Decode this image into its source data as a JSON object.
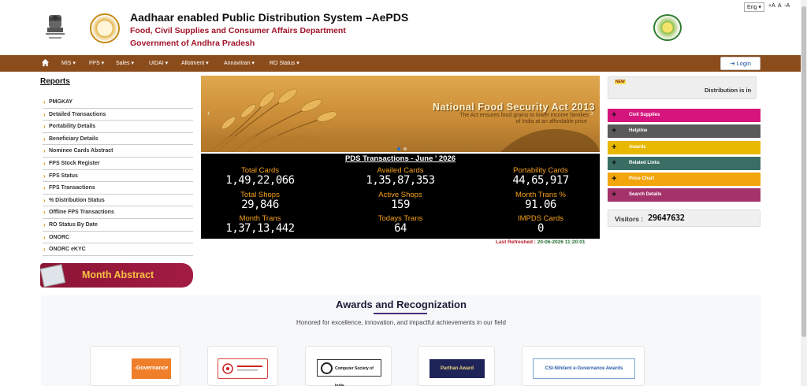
{
  "header": {
    "title": "Aadhaar enabled Public Distribution System –AePDS",
    "dept": "Food, Civil Supplies and Consumer Affairs Department",
    "govt": "Government of Andhra Pradesh",
    "language": "Eng",
    "font_size_controls": "+A  A  -A"
  },
  "nav": {
    "items": [
      "MIS",
      "FPS",
      "Sales",
      "UIDAI",
      "Allotment",
      "Annavitran",
      "RO Status"
    ],
    "login_label": "Login"
  },
  "reports": {
    "title": "Reports",
    "items": [
      "PMGKAY",
      "Detailed Transactions",
      "Portability Details",
      "Beneficiary Details",
      "Nominee Cards Abstract",
      "FPS Stock Register",
      "FPS Status",
      "FPS Transactions",
      "% Distribution Status",
      "Offline FPS Transactions",
      "RO Status By Date",
      "ONORC",
      "ONORC eKYC"
    ],
    "month_abstract": "Month Abstract"
  },
  "banner": {
    "title": "National Food Security Act 2013",
    "line1": "The Act ensures food grains to lower income families",
    "line2": "of India at an affordable price"
  },
  "stats": {
    "heading": "PDS Transactions - June ' 2026",
    "items": [
      {
        "label": "Total Cards",
        "value": "1,49,22,066"
      },
      {
        "label": "Availed Cards",
        "value": "1,35,87,353"
      },
      {
        "label": "Portability Cards",
        "value": "44,65,917"
      },
      {
        "label": "Total Shops",
        "value": "29,846"
      },
      {
        "label": "Active Shops",
        "value": "159"
      },
      {
        "label": "Month Trans %",
        "value": "91.06"
      },
      {
        "label": "Month Trans",
        "value": "1,37,13,442"
      },
      {
        "label": "Todays Trans",
        "value": "64"
      },
      {
        "label": "IMPDS Cards",
        "value": "0"
      }
    ],
    "refreshed_label": "Last Refreshed : ",
    "refreshed_value": "20-06-2026 11:20:01"
  },
  "right": {
    "news_badge": "NEW",
    "news_text": "Distribution is in",
    "links": [
      {
        "label": "Civil Supplies",
        "color": "#d6147d"
      },
      {
        "label": "Helpline",
        "color": "#5a5a5a"
      },
      {
        "label": "Awards",
        "color": "#e8b800"
      },
      {
        "label": "Related Links",
        "color": "#3a6e64"
      },
      {
        "label": "Price Chart",
        "color": "#f2a50c"
      },
      {
        "label": "Search Details",
        "color": "#a3336a"
      }
    ],
    "visitors_label": "Visitors :",
    "visitors_value": "29647632"
  },
  "awards": {
    "title": "Awards and Recognization",
    "desc": "Honored for excellence, innovation, and impactful achievements in our field",
    "cards": [
      "-Governance",
      "",
      "Computer Society of India",
      "Parthan Award",
      "CSI-Nihilent e-Governance Awards"
    ]
  }
}
